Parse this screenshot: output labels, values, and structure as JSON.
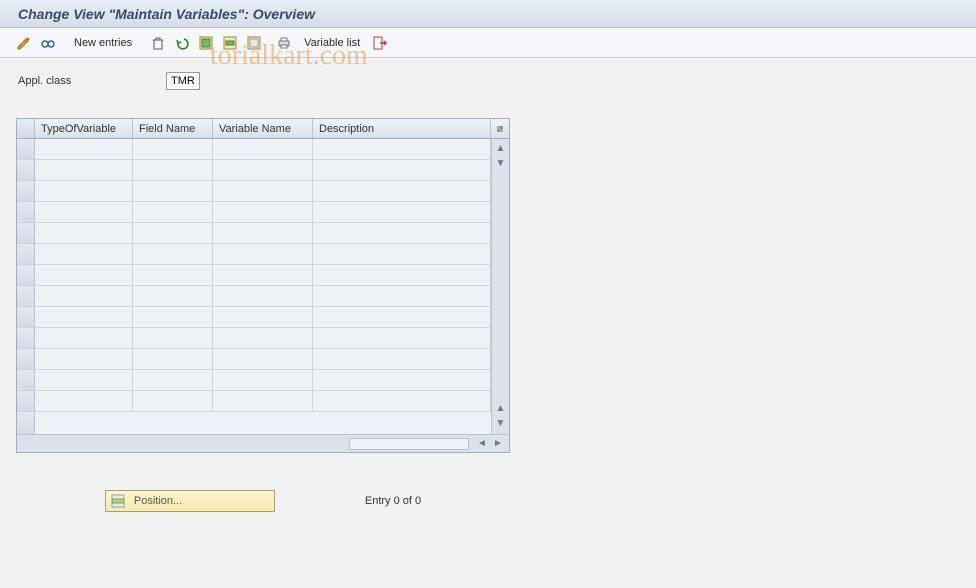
{
  "title": "Change View \"Maintain Variables\": Overview",
  "toolbar": {
    "new_entries": "New entries",
    "variable_list": "Variable list"
  },
  "form": {
    "appl_class_label": "Appl. class",
    "appl_class_value": "TMR"
  },
  "table": {
    "columns": {
      "type_of_variable": "TypeOfVariable",
      "field_name": "Field Name",
      "variable_name": "Variable Name",
      "description": "Description"
    },
    "row_count": 13
  },
  "footer": {
    "position_label": "Position...",
    "entry_text": "Entry 0 of 0"
  },
  "watermark": "torialkart.com"
}
